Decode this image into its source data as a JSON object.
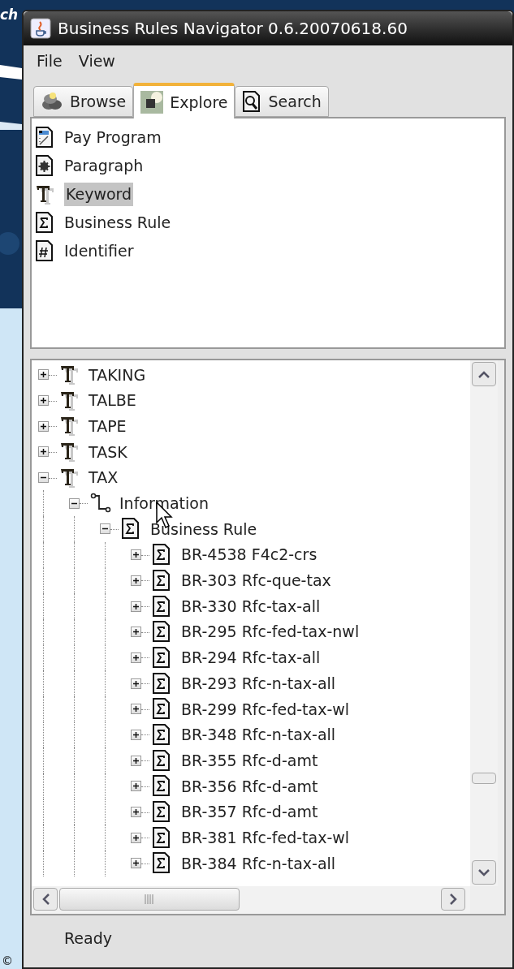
{
  "desktop": {
    "texts": [
      "ch",
      "©"
    ]
  },
  "window": {
    "title": "Business Rules Navigator 0.6.20070618.60"
  },
  "menu": [
    "File",
    "View"
  ],
  "tabs": [
    {
      "label": "Browse",
      "kind": "browse",
      "selected": false
    },
    {
      "label": "Explore",
      "kind": "explore",
      "selected": true
    },
    {
      "label": "Search",
      "kind": "search",
      "selected": false
    }
  ],
  "types": [
    {
      "label": "Pay Program",
      "kind": "program",
      "selected": false
    },
    {
      "label": "Paragraph",
      "kind": "paragraph",
      "selected": false
    },
    {
      "label": "Keyword",
      "kind": "keyword",
      "selected": true
    },
    {
      "label": "Business Rule",
      "kind": "rule",
      "selected": false
    },
    {
      "label": "Identifier",
      "kind": "identifier",
      "selected": false
    }
  ],
  "tree": [
    {
      "label": "TAKING",
      "kind": "keyword",
      "expanded": false
    },
    {
      "label": "TALBE",
      "kind": "keyword",
      "expanded": false
    },
    {
      "label": "TAPE",
      "kind": "keyword",
      "expanded": false
    },
    {
      "label": "TASK",
      "kind": "keyword",
      "expanded": false
    },
    {
      "label": "TAX",
      "kind": "keyword",
      "expanded": true,
      "children": [
        {
          "label": "Information",
          "kind": "information",
          "expanded": true,
          "children": [
            {
              "label": "Business Rule",
              "kind": "rule",
              "expanded": true,
              "children": [
                {
                  "label": "BR-4538 F4c2-crs",
                  "kind": "rule",
                  "expanded": false
                },
                {
                  "label": "BR-303 Rfc-que-tax",
                  "kind": "rule",
                  "expanded": false
                },
                {
                  "label": "BR-330 Rfc-tax-all",
                  "kind": "rule",
                  "expanded": false
                },
                {
                  "label": "BR-295 Rfc-fed-tax-nwl",
                  "kind": "rule",
                  "expanded": false
                },
                {
                  "label": "BR-294 Rfc-tax-all",
                  "kind": "rule",
                  "expanded": false
                },
                {
                  "label": "BR-293 Rfc-n-tax-all",
                  "kind": "rule",
                  "expanded": false
                },
                {
                  "label": "BR-299 Rfc-fed-tax-wl",
                  "kind": "rule",
                  "expanded": false
                },
                {
                  "label": "BR-348 Rfc-n-tax-all",
                  "kind": "rule",
                  "expanded": false
                },
                {
                  "label": "BR-355 Rfc-d-amt",
                  "kind": "rule",
                  "expanded": false
                },
                {
                  "label": "BR-356 Rfc-d-amt",
                  "kind": "rule",
                  "expanded": false
                },
                {
                  "label": "BR-357 Rfc-d-amt",
                  "kind": "rule",
                  "expanded": false
                },
                {
                  "label": "BR-381 Rfc-fed-tax-wl",
                  "kind": "rule",
                  "expanded": false
                },
                {
                  "label": "BR-384 Rfc-n-tax-all",
                  "kind": "rule",
                  "expanded": false
                }
              ]
            }
          ]
        }
      ]
    }
  ],
  "status_bar": "Ready"
}
